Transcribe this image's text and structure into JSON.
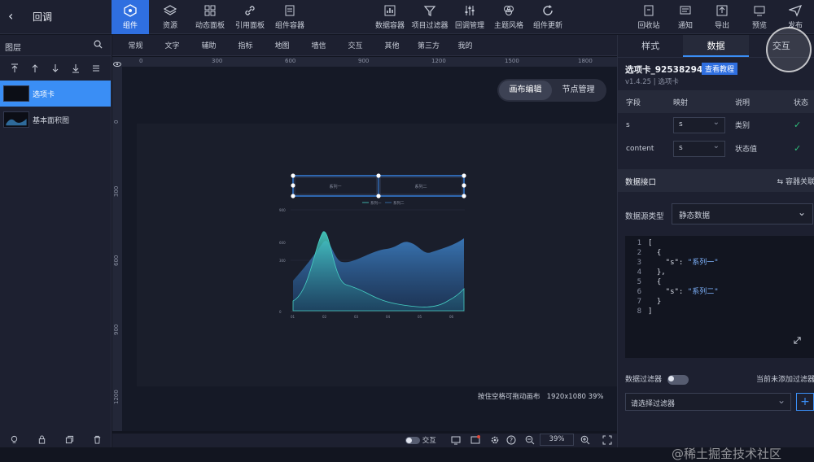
{
  "header": {
    "back_label": "‹",
    "title": "回调",
    "tools_left": [
      {
        "label": "组件",
        "icon": "component-icon",
        "active": true
      },
      {
        "label": "资源",
        "icon": "layers-icon"
      },
      {
        "label": "动态面板",
        "icon": "dynamic-panel-icon"
      },
      {
        "label": "引用面板",
        "icon": "link-icon"
      },
      {
        "label": "组件容器",
        "icon": "container-icon"
      }
    ],
    "tools_mid": [
      {
        "label": "数据容器",
        "icon": "data-container-icon"
      },
      {
        "label": "项目过滤器",
        "icon": "filter-icon"
      },
      {
        "label": "回调管理",
        "icon": "sliders-icon"
      },
      {
        "label": "主题风格",
        "icon": "palette-icon"
      },
      {
        "label": "组件更新",
        "icon": "refresh-icon"
      }
    ],
    "tools_right": [
      {
        "label": "回收站",
        "icon": "trash-box-icon"
      },
      {
        "label": "通知",
        "icon": "message-icon"
      },
      {
        "label": "导出",
        "icon": "export-icon"
      },
      {
        "label": "预览",
        "icon": "preview-icon"
      },
      {
        "label": "发布",
        "icon": "send-icon"
      }
    ]
  },
  "layers": {
    "title": "图层",
    "items": [
      {
        "label": "选项卡",
        "selected": true
      },
      {
        "label": "基本面积图",
        "selected": false
      }
    ]
  },
  "component_tabs": [
    "常规",
    "文字",
    "辅助",
    "指标",
    "地图",
    "墙信",
    "交互",
    "其他",
    "第三方",
    "我的"
  ],
  "ruler": {
    "h_ticks": [
      "0",
      "300",
      "600",
      "900",
      "1200",
      "1500",
      "1800"
    ],
    "v_ticks": [
      "0",
      "300",
      "600",
      "900",
      "1200"
    ]
  },
  "canvas": {
    "mode_buttons": [
      "画布编辑",
      "节点管理"
    ],
    "active_mode": "画布编辑",
    "hint": "按住空格可拖动画布",
    "size_info": "1920x1080 39%"
  },
  "preview_chart": {
    "tabs": [
      "系列一",
      "系列二"
    ],
    "legend": [
      "系列一",
      "系列二"
    ],
    "y_labels": [
      "900",
      "600",
      "300",
      "0"
    ],
    "x_labels": [
      "01",
      "02",
      "03",
      "04",
      "05",
      "06"
    ]
  },
  "bottombar": {
    "interact_label": "交互",
    "zoom": "39%"
  },
  "right_panel": {
    "tabs": [
      "样式",
      "数据",
      "交互"
    ],
    "active_tab": "数据",
    "component_name": "选项卡_92538294",
    "doc_button": "查看教程",
    "version": "v1.4.25 | 选项卡",
    "field_headers": [
      "字段",
      "映射",
      "说明",
      "状态"
    ],
    "fields": [
      {
        "field": "s",
        "map": "s",
        "desc": "类别",
        "ok": "✓"
      },
      {
        "field": "content",
        "map": "s",
        "desc": "状态值",
        "ok": "✓"
      }
    ],
    "data_interface_title": "数据接口",
    "container_link": "⇆ 容器关联",
    "datasource_label": "数据源类型",
    "datasource_value": "静态数据",
    "code_lines": [
      {
        "n": "1",
        "t": "["
      },
      {
        "n": "2",
        "t": "  {"
      },
      {
        "n": "3",
        "t": "    \"s\": ",
        "s": "\"系列一\""
      },
      {
        "n": "4",
        "t": "  },"
      },
      {
        "n": "5",
        "t": "  {"
      },
      {
        "n": "6",
        "t": "    \"s\": ",
        "s": "\"系列二\""
      },
      {
        "n": "7",
        "t": "  }"
      },
      {
        "n": "8",
        "t": "]"
      }
    ],
    "filter_label": "数据过滤器",
    "filter_status": "当前未添加过滤器",
    "filter_placeholder": "请选择过滤器",
    "add_label": "+"
  },
  "watermark": "@稀土掘金技术社区",
  "colors": {
    "accent": "#2f6fe0",
    "selected_layer": "#3a8ef5",
    "check": "#2fbf7b"
  }
}
